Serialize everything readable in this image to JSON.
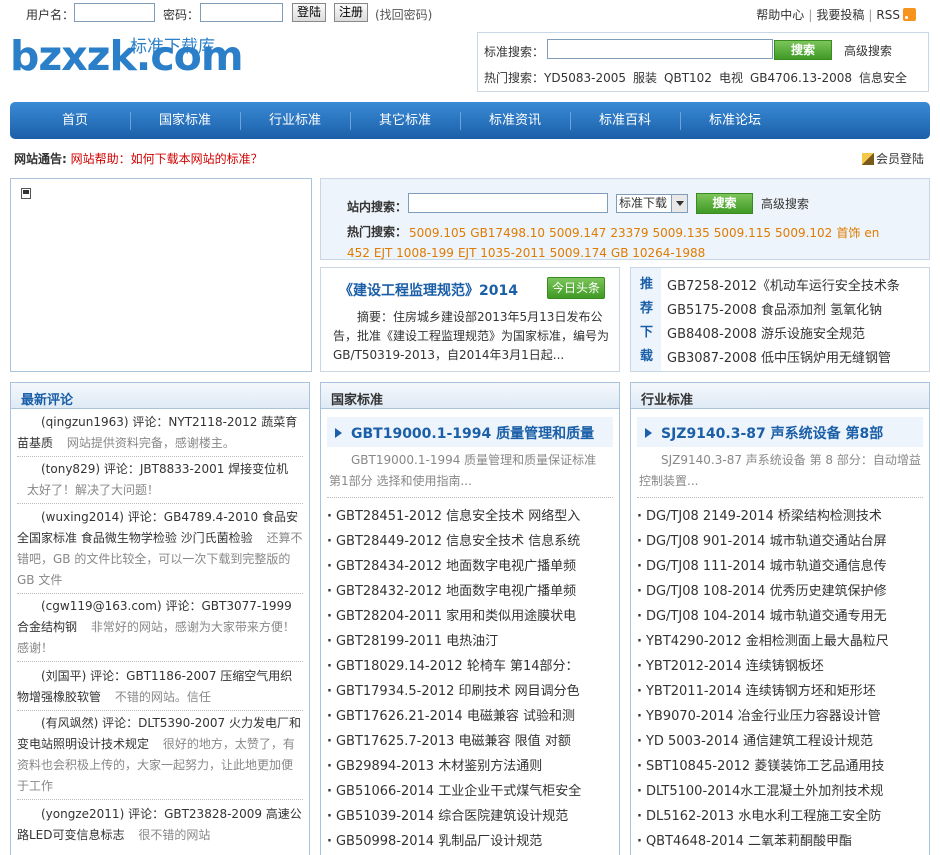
{
  "topbar": {
    "username_label": "用户名：",
    "password_label": "密码：",
    "login_button": "登陆",
    "register_button": "注册",
    "recover_link": "(找回密码)",
    "links": [
      "帮助中心",
      "我要投稿",
      "RSS"
    ]
  },
  "logo": {
    "main": "bzxzk.com",
    "sub": "标准下载库"
  },
  "top_search": {
    "label": "标准搜索：",
    "button": "搜索",
    "advanced": "高级搜索",
    "hot_label": "热门搜索：",
    "hot": [
      "YD5083-2005",
      "服装",
      "QBT102",
      "电视",
      "GB4706.13-2008",
      "信息安全"
    ]
  },
  "nav": [
    "首页",
    "国家标准",
    "行业标准",
    "其它标准",
    "标准资讯",
    "标准百科",
    "标准论坛"
  ],
  "notice": {
    "label": "网站通告:",
    "text": "网站帮助：如何下载本网站的标准？",
    "member_login": "会员登陆"
  },
  "site_search": {
    "label": "站内搜索：",
    "select_value": "标准下载",
    "button": "搜索",
    "advanced": "高级搜索",
    "hot_label": "热门搜索：",
    "hot": [
      "5009.105",
      "GB17498.10",
      "5009.147",
      "23379",
      "5009.135",
      "5009.115",
      "5009.102",
      "首饰",
      "en 452",
      "EJT 1008-199",
      "EJT 1035-2011",
      "5009.174",
      "GB 10264-1988"
    ]
  },
  "headline": {
    "title": "《建设工程监理规范》2014",
    "badge": "今日头条",
    "body": "摘要：住房城乡建设部2013年5月13日发布公告，批准《建设工程监理规范》为国家标准，编号为GB/T50319-2013，自2014年3月1日起..."
  },
  "recommend": {
    "side": [
      "推",
      "荐",
      "下",
      "载"
    ],
    "items": [
      "GB7258-2012《机动车运行安全技术条",
      "GB5175-2008 食品添加剂 氢氧化钠",
      "GB8408-2008 游乐设施安全规范",
      "GB3087-2008 低中压锅炉用无缝钢管"
    ]
  },
  "comments": {
    "title": "最新评论",
    "items": [
      {
        "text": "(qingzun1963) 评论：NYT2118-2012 蔬菜育苗基质",
        "note": "网站提供资料完备，感谢楼主。"
      },
      {
        "text": "(tony829) 评论：JBT8833-2001 焊接变位机",
        "note": "太好了！解决了大问题！"
      },
      {
        "text": "(wuxing2014) 评论：GB4789.4-2010 食品安全国家标准 食品微生物学检验 沙门氏菌检验",
        "note": "还算不错吧，GB 的文件比较全，可以一次下载到完整版的 GB 文件"
      },
      {
        "text": "(cgw119@163.com) 评论：GBT3077-1999 合金结构钢",
        "note": "非常好的网站，感谢为大家带来方便！感谢！"
      },
      {
        "text": "(刘国平) 评论：GBT1186-2007 压缩空气用织物增强橡胶软管",
        "note": "不错的网站。信任"
      },
      {
        "text": "(有风飒然) 评论：DLT5390-2007 火力发电厂和变电站照明设计技术规定",
        "note": "很好的地方，太赞了，有资料也会积极上传的，大家一起努力，让此地更加便于工作"
      },
      {
        "text": "(yongze2011) 评论：GBT23828-2009 高速公路LED可变信息标志",
        "note": "很不错的网站"
      }
    ]
  },
  "national": {
    "title": "国家标准",
    "featured_title": "GBT19000.1-1994 质量管理和质量",
    "featured_desc": "GBT19000.1-1994 质量管理和质量保证标准 第1部分 选择和使用指南...",
    "items": [
      "GBT28451-2012 信息安全技术 网络型入",
      "GBT28449-2012 信息安全技术 信息系统",
      "GBT28434-2012 地面数字电视广播单频",
      "GBT28432-2012 地面数字电视广播单频",
      "GBT28204-2011 家用和类似用途膜状电",
      "GBT28199-2011 电热油汀",
      "GBT18029.14-2012 轮椅车 第14部分：",
      "GBT17934.5-2012 印刷技术 网目调分色",
      "GBT17626.21-2014 电磁兼容 试验和测",
      "GBT17625.7-2013 电磁兼容 限值 对额",
      "GB29894-2013 木材鉴别方法通则",
      "GB51066-2014 工业企业干式煤气柜安全",
      "GB51039-2014 综合医院建筑设计规范",
      "GB50998-2014 乳制品厂设计规范"
    ]
  },
  "industry": {
    "title": "行业标准",
    "featured_title": "SJZ9140.3-87 声系统设备 第8部",
    "featured_desc": "SJZ9140.3-87 声系统设备 第 8 部分：自动增益控制装置...",
    "items": [
      "DG/TJ08 2149-2014 桥梁结构检测技术",
      "DG/TJ08 901-2014 城市轨道交通站台屏",
      "DG/TJ08 111-2014 城市轨道交通信息传",
      "DG/TJ08 108-2014 优秀历史建筑保护修",
      "DG/TJ08 104-2014 城市轨道交通专用无",
      "YBT4290-2012 金相检测面上最大晶粒尺",
      "YBT2012-2014 连续铸钢板坯",
      "YBT2011-2014 连续铸钢方坯和矩形坯",
      "YB9070-2014 冶金行业压力容器设计管",
      "YD 5003-2014 通信建筑工程设计规范",
      "SBT10845-2012 菱镁装饰工艺品通用技",
      "DLT5100-2014水工混凝土外加剂技术规",
      "DL5162-2013 水电水利工程施工安全防",
      "QBT4648-2014 二氧苯莉酮酸甲酯"
    ]
  }
}
